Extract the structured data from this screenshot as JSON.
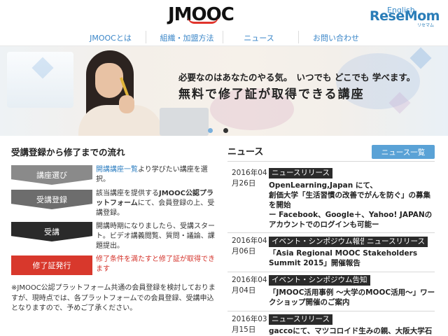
{
  "header": {
    "logo": "JMOOC",
    "english_link": "English",
    "watermark": "ReseMom",
    "watermark_sub": "リセマム"
  },
  "nav": {
    "items": [
      {
        "label": "JMOOCとは"
      },
      {
        "label": "組織・加盟方法"
      },
      {
        "label": "ニュース"
      },
      {
        "label": "お問い合わせ"
      }
    ]
  },
  "hero": {
    "line1_a": "必要なのはあなたのやる気。",
    "line1_b": "いつでも どこでも 学べます。",
    "line2": "無料で修了証が取得できる講座",
    "slide_count": 2,
    "active_slide": 1
  },
  "flow": {
    "title": "受講登録から修了までの流れ",
    "steps": [
      {
        "label": "講座選び",
        "color": "#8a8a8a",
        "desc_link": "開講講座一覧",
        "desc": "より学びたい講座を選択。"
      },
      {
        "label": "受講登録",
        "color": "#6d6d6d",
        "desc_a": "該当講座を提供する",
        "desc_b": "JMOOC公認プラットフォーム",
        "desc_c": "にて、会員登録の上、受講登録。"
      },
      {
        "label": "受講",
        "color": "#2a2a2a",
        "desc": "開講時期になりましたら、受講スタート。ビデオ講義閲覧、質問・議論、課題提出。"
      },
      {
        "label": "修了証発行",
        "color": "#d8382c",
        "desc": "修了条件を満たすと修了証が取得できます"
      }
    ],
    "note": "※JMOOC公認プラットフォーム共通の会員登録を検討しておりますが、現時点では、各プラットフォームでの会員登録、受講申込となりますので、予めご了承ください。"
  },
  "news": {
    "title": "ニュース",
    "all_button": "ニュース一覧",
    "items": [
      {
        "date_year": "2016年04",
        "date_day": "月26日",
        "tags": [
          "ニュースリリース"
        ],
        "text_a": "OpenLearning,Japan にて、",
        "text_b": "創価大学「生活習慣の改善でがんを防ぐ」の募集を開始",
        "text_c": "ー Facebook、Google＋、Yahoo! JAPANのアカウントでのログインも可能ー"
      },
      {
        "date_year": "2016年04",
        "date_day": "月06日",
        "tags": [
          "イベント・シンポジウム報告",
          "ニュースリリース"
        ],
        "text": "「Asia Regional MOOC Stakeholders Summit 2015」開催報告"
      },
      {
        "date_year": "2016年04",
        "date_day": "月04日",
        "tags": [
          "イベント・シンポジウム告知"
        ],
        "text": "「JMOOC活用事例 〜大学のMOOC活用〜」ワークショップ開催のご案内"
      },
      {
        "date_year": "2016年03",
        "date_day": "月15日",
        "tags": [
          "ニュースリリース"
        ],
        "text": "gaccoにて、マツコロイド生みの親、大阪大学石"
      }
    ]
  },
  "colors": {
    "accent_blue": "#3a86c8",
    "button_blue": "#5aa2d6",
    "tag_black": "#2b2b2b",
    "red": "#d8382c"
  }
}
